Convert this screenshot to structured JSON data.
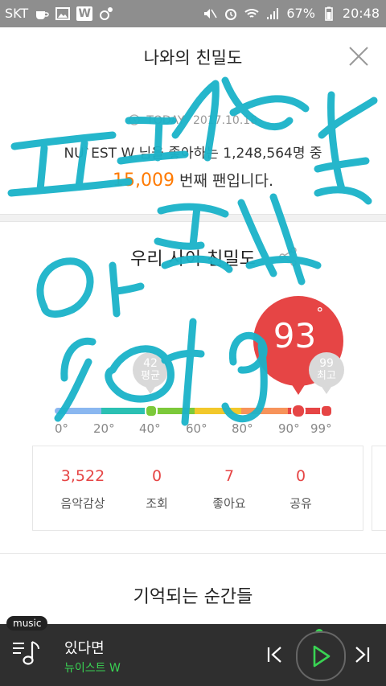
{
  "status_bar": {
    "carrier": "SKT",
    "w_badge": "W",
    "battery": "67%",
    "time": "20:48"
  },
  "header": {
    "title": "나와의 친밀도"
  },
  "fan_info": {
    "today_label": "TODAY",
    "date": "2017.10.18",
    "line1": "NU`EST W 님을 좋아하는 1,248,564명 중",
    "fan_number": "15,009",
    "line2_suffix": " 번째 팬입니다."
  },
  "intimacy": {
    "section_title": "우리 사이 친밀도",
    "score": "93",
    "degree": "°",
    "average": {
      "value": "42",
      "label": "평균"
    },
    "best": {
      "value": "99",
      "label": "최고"
    },
    "ticks": [
      "0°",
      "20°",
      "40°",
      "60°",
      "80°",
      "90°",
      "99°"
    ]
  },
  "stats": [
    {
      "value": "3,522",
      "label": "음악감상"
    },
    {
      "value": "0",
      "label": "조회"
    },
    {
      "value": "7",
      "label": "좋아요"
    },
    {
      "value": "0",
      "label": "공유"
    }
  ],
  "moments": {
    "title": "기억되는 순간들"
  },
  "player": {
    "badge": "music",
    "song_title": "있다면",
    "artist": "뉴이스트 W"
  },
  "colors": {
    "accent_red": "#e64545",
    "accent_orange": "#ff7a00",
    "accent_green": "#39d353",
    "scribble": "#1ab3c9"
  }
}
